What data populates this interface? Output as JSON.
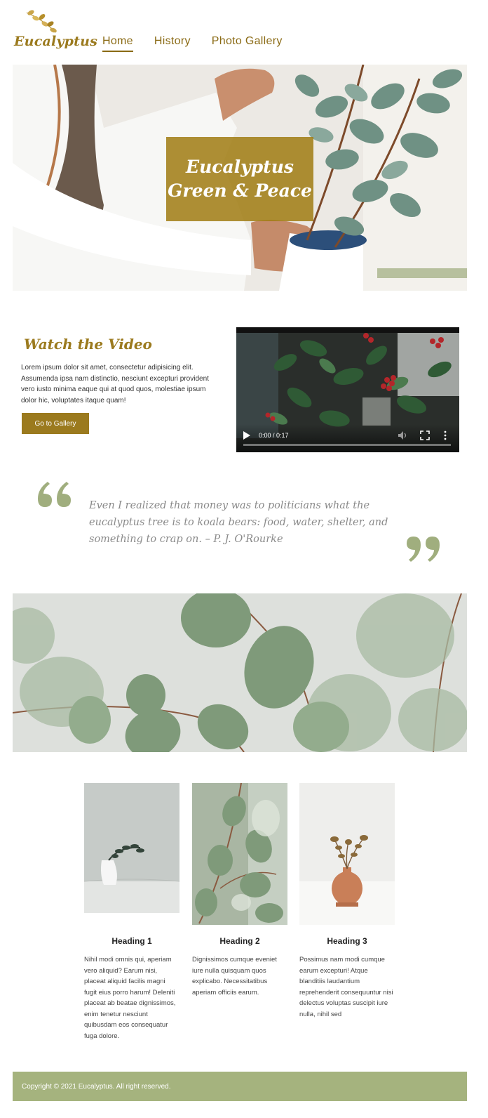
{
  "brand": {
    "name": "Eucalyptus",
    "color": "#9b7a1e"
  },
  "nav": {
    "items": [
      {
        "label": "Home",
        "active": true
      },
      {
        "label": "History",
        "active": false
      },
      {
        "label": "Photo Gallery",
        "active": false
      }
    ]
  },
  "hero": {
    "title_line1": "Eucalyptus",
    "title_line2": "Green & Peace"
  },
  "video": {
    "heading": "Watch the Video",
    "text": "Lorem ipsum dolor sit amet, consectetur adipisicing elit. Assumenda ipsa nam distinctio, nesciunt excepturi provident vero iusto minima eaque qui at quod quos, molestiae ipsum dolor hic, voluptates itaque quam!",
    "button_label": "Go to Gallery",
    "player": {
      "time": "0:00 / 0:17",
      "progress": 0
    }
  },
  "quote": {
    "text": "Even I realized that money was to politicians what the eucalyptus tree is to koala bears: food, water, shelter, and something to crap on. – P. J. O'Rourke",
    "mark_color": "#a0ae7e"
  },
  "cards": [
    {
      "heading": "Heading 1",
      "text": "Nihil modi omnis qui, aperiam vero aliquid? Earum nisi, placeat aliquid facilis magni fugit eius porro harum! Deleniti placeat ab beatae dignissimos, enim tenetur nesciunt quibusdam eos consequatur fuga dolore."
    },
    {
      "heading": "Heading 2",
      "text": "Dignissimos cumque eveniet iure nulla quisquam quos explicabo. Necessitatibus aperiam officiis earum."
    },
    {
      "heading": "Heading 3",
      "text": "Possimus nam modi cumque earum excepturi! Atque blanditiis laudantium reprehenderit consequuntur nisi delectus voluptas suscipit iure nulla, nihil sed"
    }
  ],
  "footer": {
    "copyright": "Copyright © 2021 Eucalyptus. All right reserved.",
    "color": "#a5b37e"
  }
}
